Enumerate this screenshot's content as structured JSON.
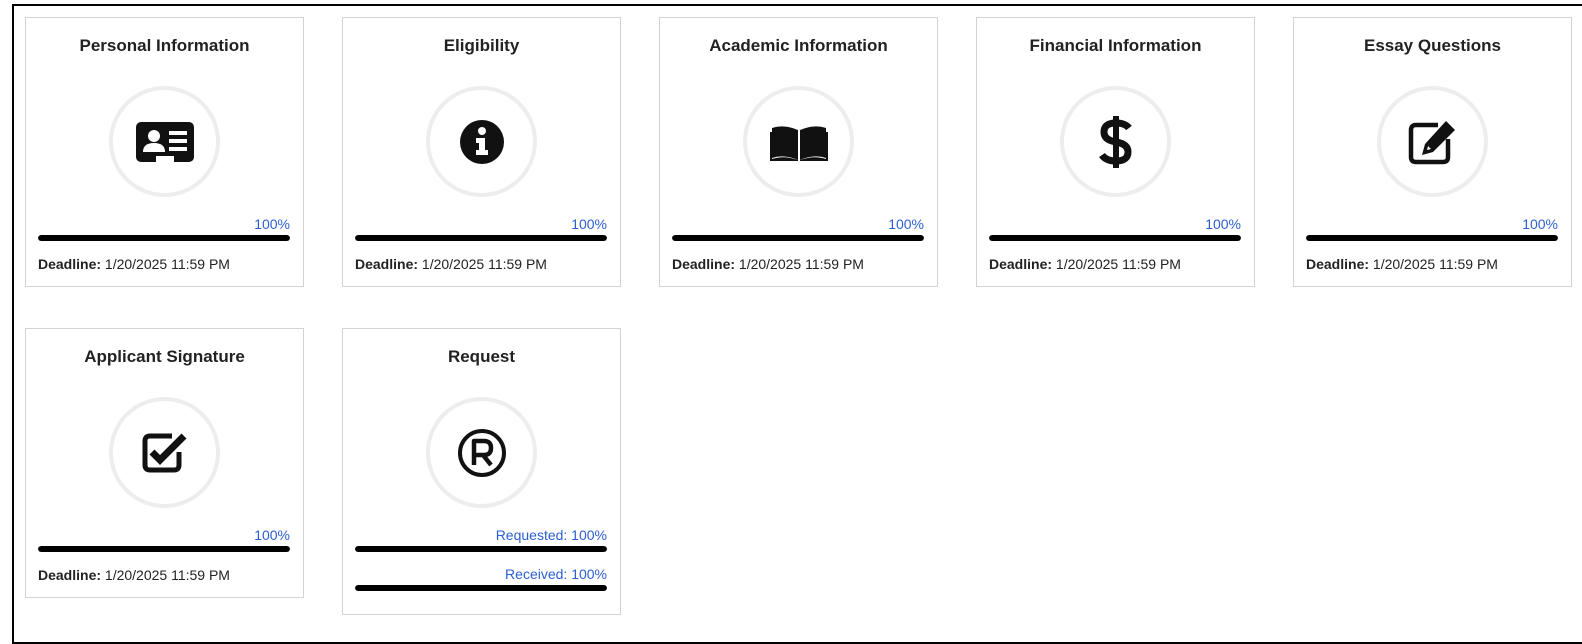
{
  "cards": [
    {
      "title": "Personal Information",
      "icon": "id-card-icon",
      "percent_label": "100%",
      "progress": 1.0,
      "deadline_label": "Deadline:",
      "deadline_value": "1/20/2025 11:59 PM"
    },
    {
      "title": "Eligibility",
      "icon": "info-icon",
      "percent_label": "100%",
      "progress": 1.0,
      "deadline_label": "Deadline:",
      "deadline_value": "1/20/2025 11:59 PM"
    },
    {
      "title": "Academic Information",
      "icon": "book-open-icon",
      "percent_label": "100%",
      "progress": 1.0,
      "deadline_label": "Deadline:",
      "deadline_value": "1/20/2025 11:59 PM"
    },
    {
      "title": "Financial Information",
      "icon": "dollar-icon",
      "percent_label": "100%",
      "progress": 1.0,
      "deadline_label": "Deadline:",
      "deadline_value": "1/20/2025 11:59 PM"
    },
    {
      "title": "Essay Questions",
      "icon": "edit-icon",
      "percent_label": "100%",
      "progress": 1.0,
      "deadline_label": "Deadline:",
      "deadline_value": "1/20/2025 11:59 PM"
    },
    {
      "title": "Applicant Signature",
      "icon": "checkbox-icon",
      "percent_label": "100%",
      "progress": 1.0,
      "deadline_label": "Deadline:",
      "deadline_value": "1/20/2025 11:59 PM"
    }
  ],
  "request_card": {
    "title": "Request",
    "icon": "registered-icon",
    "requested_label": "Requested: 100%",
    "requested_progress": 1.0,
    "received_label": "Received: 100%",
    "received_progress": 1.0
  },
  "colors": {
    "accent": "#2b5fd0",
    "bar": "#000000",
    "circle": "#ededed",
    "border": "#d3d3d3"
  }
}
